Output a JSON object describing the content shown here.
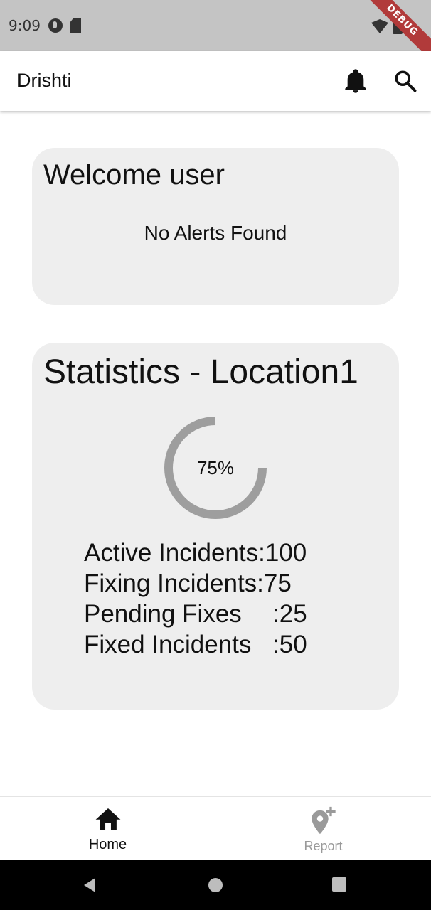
{
  "status_bar": {
    "time": "9:09"
  },
  "debug_banner": "DEBUG",
  "app_bar": {
    "title": "Drishti"
  },
  "welcome": {
    "title": "Welcome user",
    "alerts": "No Alerts Found"
  },
  "statistics": {
    "title": "Statistics - Location1",
    "progress": {
      "value": 0.75,
      "label": "75%"
    },
    "items": [
      {
        "label": "Active Incidents ",
        "value": ":100"
      },
      {
        "label": "Fixing Incidents ",
        "value": ":75"
      },
      {
        "label": "Pending Fixes",
        "value": ":25"
      },
      {
        "label": "Fixed Incidents",
        "value": ":50"
      }
    ]
  },
  "colors": {
    "card_bg": "#eeeeee",
    "progress_track": "#eeeeee",
    "progress_fill": "#9e9e9e",
    "nav_active": "#111111",
    "nav_inactive": "#9a9a9a"
  },
  "bottom_nav": {
    "items": [
      {
        "label": "Home",
        "icon": "home-icon",
        "active": true
      },
      {
        "label": "Report",
        "icon": "add-location-icon",
        "active": false
      }
    ]
  },
  "system_nav": {
    "icons": [
      "back-icon",
      "home-circle-icon",
      "recents-icon"
    ]
  }
}
